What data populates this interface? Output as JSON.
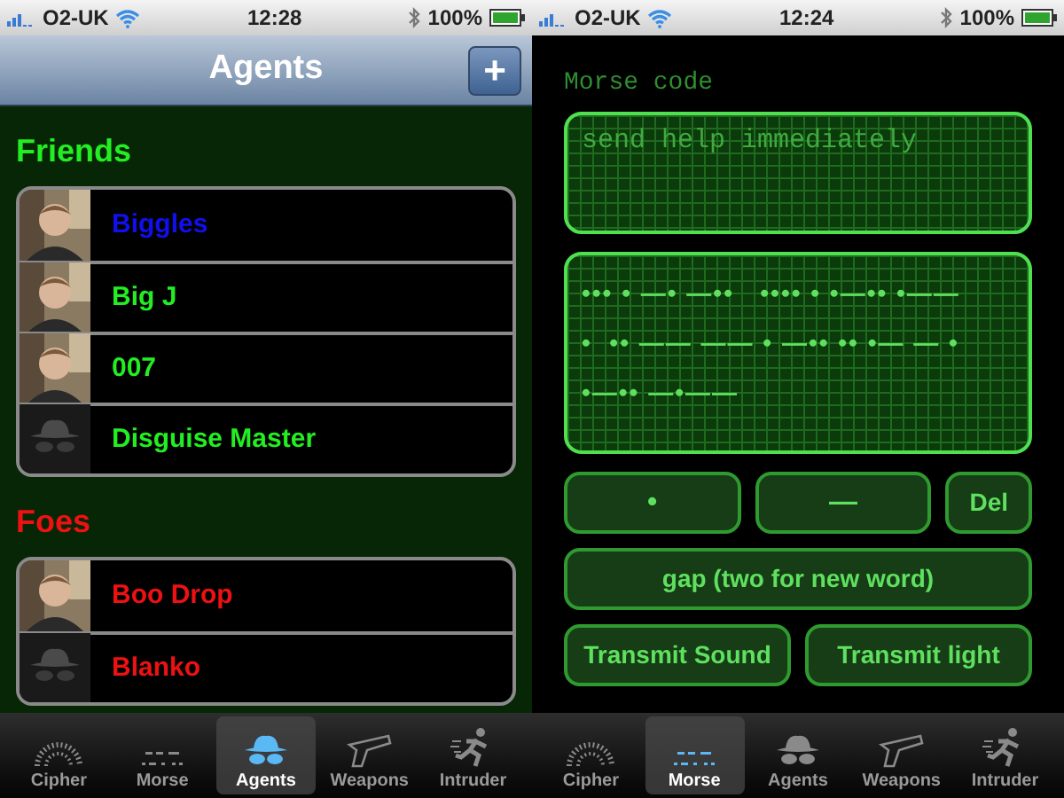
{
  "screens": [
    {
      "kind": "agents",
      "status_bar": {
        "carrier": "O2-UK",
        "time": "12:28",
        "battery": "100%"
      },
      "nav": {
        "title": "Agents",
        "button": "+"
      },
      "sections": [
        {
          "title": "Friends",
          "color": "#22ee22",
          "rows": [
            {
              "name": "Biggles",
              "color": "#1010ee"
            },
            {
              "name": "Big J",
              "color": "#22ee22"
            },
            {
              "name": "007",
              "color": "#22ee22"
            },
            {
              "name": "Disguise Master",
              "color": "#22ee22",
              "kind": "disguise"
            }
          ]
        },
        {
          "title": "Foes",
          "color": "#ee1111",
          "rows": [
            {
              "name": "Boo Drop",
              "color": "#ee1111"
            },
            {
              "name": "Blanko",
              "color": "#ee1111",
              "kind": "disguise"
            }
          ]
        }
      ],
      "tabs": [
        {
          "label": "Cipher",
          "selected": false
        },
        {
          "label": "Morse",
          "selected": false
        },
        {
          "label": "Agents",
          "selected": true
        },
        {
          "label": "Weapons",
          "selected": false
        },
        {
          "label": "Intruder",
          "selected": false
        }
      ]
    },
    {
      "kind": "morse",
      "status_bar": {
        "carrier": "O2-UK",
        "time": "12:24",
        "battery": "100%"
      },
      "label": "Morse code",
      "input": "send help immediately",
      "output_lines": [
        "••• • —• —••   •••• • •—•• •——",
        "•  •• —— —— • —•• •• •— — •",
        "•—•• —•——"
      ],
      "button_rows": [
        [
          "•",
          "—",
          "Del"
        ],
        [
          "gap (two for new word)"
        ],
        [
          "Transmit Sound",
          "Transmit light"
        ]
      ],
      "tabs": [
        {
          "label": "Cipher",
          "selected": false
        },
        {
          "label": "Morse",
          "selected": true
        },
        {
          "label": "Agents",
          "selected": false
        },
        {
          "label": "Weapons",
          "selected": false
        },
        {
          "label": "Intruder",
          "selected": false
        }
      ]
    }
  ]
}
